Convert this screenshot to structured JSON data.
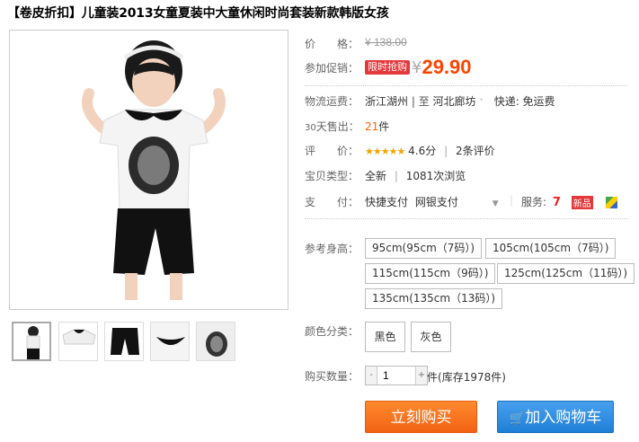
{
  "title": "【卷皮折扣】儿童装2013女童夏装中大童休闲时尚套装新款韩版女孩",
  "price": {
    "label": "价　　格：",
    "original": "¥ 138.00"
  },
  "promo": {
    "label": "参加促销：",
    "tag": "限时抢购",
    "currency": "¥",
    "price": "29.90"
  },
  "shipping": {
    "label": "物流运费：",
    "from": "浙江湖州",
    "sep": "| 至",
    "to": "河北廊坊",
    "express": "快递: 免运费"
  },
  "sales": {
    "label_num": "30",
    "label": "天售出：",
    "count": "21",
    "unit": "件"
  },
  "rating": {
    "label": "评　　价：",
    "stars": "★★★★★",
    "score": "4.6分",
    "sep": "|",
    "reviews": "2条评价"
  },
  "item_type": {
    "label": "宝贝类型：",
    "type": "全新",
    "sep": "|",
    "views": "1081次浏览"
  },
  "payment": {
    "label": "支　　付：",
    "method1": "快捷支付",
    "method2": "网银支付",
    "services_label": "服务:",
    "badge_new": "新品"
  },
  "size": {
    "label": "参考身高：",
    "options": [
      "95cm(95cm（7码）)",
      "105cm(105cm（7码）)",
      "115cm(115cm（9码）)",
      "125cm(125cm（11码）)",
      "135cm(135cm（13码）)"
    ]
  },
  "color": {
    "label": "颜色分类：",
    "options": [
      "黑色",
      "灰色"
    ]
  },
  "quantity": {
    "label": "购买数量：",
    "minus": "-",
    "value": "1",
    "plus": "+",
    "unit": "件",
    "stock": "(库存1978件)"
  },
  "actions": {
    "buy": "立刻购买",
    "cart": "加入购物车"
  },
  "colors": {
    "accent": "#ff4400",
    "buy": "#f26214",
    "cart": "#1f7fd6",
    "promo_tag": "#e4393c"
  }
}
